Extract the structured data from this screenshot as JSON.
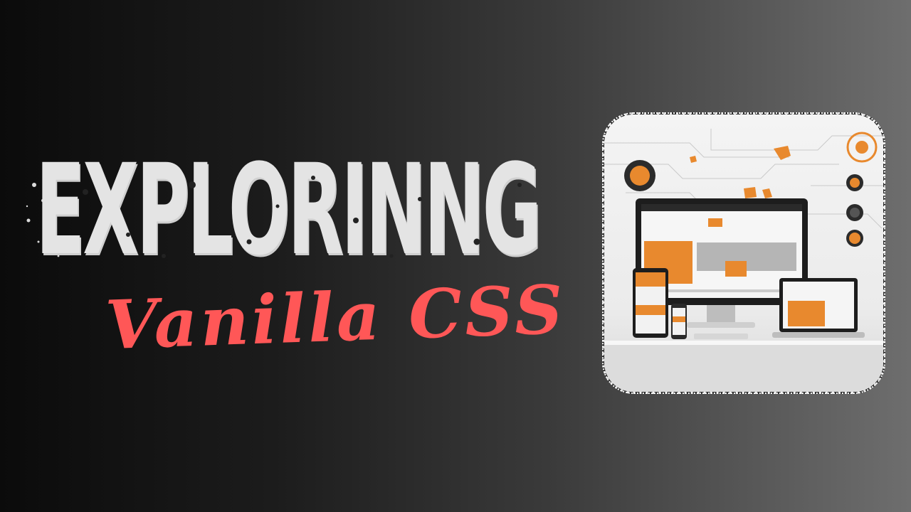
{
  "headline": "EXPLORINNG",
  "subtitle": "Vanilla CSS",
  "colors": {
    "headline": "#e4e4e4",
    "subtitle": "#ff5757",
    "accent": "#e8892e",
    "frame_bg": "#f2f2f2"
  }
}
